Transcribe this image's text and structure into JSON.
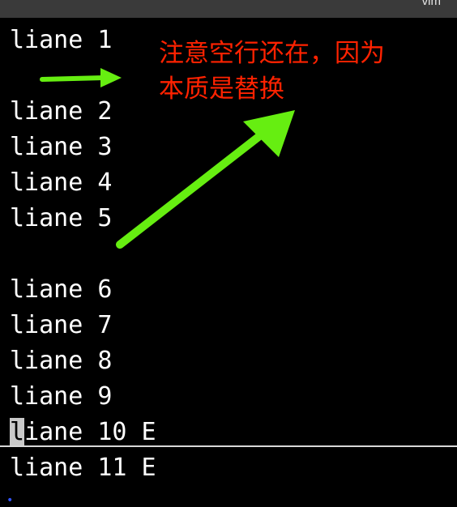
{
  "window": {
    "title": "vim"
  },
  "buffer": {
    "lines": [
      {
        "prefix": "",
        "cursor_char": "",
        "text": "liane 1"
      },
      {
        "prefix": "",
        "cursor_char": "",
        "text": ""
      },
      {
        "prefix": "",
        "cursor_char": "",
        "text": "liane 2"
      },
      {
        "prefix": "",
        "cursor_char": "",
        "text": "liane 3"
      },
      {
        "prefix": "",
        "cursor_char": "",
        "text": "liane 4"
      },
      {
        "prefix": "",
        "cursor_char": "",
        "text": "liane 5"
      },
      {
        "prefix": "",
        "cursor_char": "",
        "text": ""
      },
      {
        "prefix": "",
        "cursor_char": "",
        "text": "liane 6"
      },
      {
        "prefix": "",
        "cursor_char": "",
        "text": "liane 7"
      },
      {
        "prefix": "",
        "cursor_char": "",
        "text": "liane 8"
      },
      {
        "prefix": "",
        "cursor_char": "",
        "text": "liane 9"
      },
      {
        "prefix": "",
        "cursor_char": "l",
        "text": "iane 10 E"
      },
      {
        "prefix": "",
        "cursor_char": "",
        "text": "liane 11 E"
      }
    ]
  },
  "annotation": {
    "text": "注意空行还在，因为\n本质是替换"
  },
  "colors": {
    "background": "#000000",
    "text": "#ffffff",
    "annotation": "#ff2200",
    "arrow": "#66ee11",
    "cursor": "#c9c9c9"
  },
  "icons": {
    "arrows": [
      "green-arrow-icon",
      "green-arrow-icon"
    ]
  }
}
